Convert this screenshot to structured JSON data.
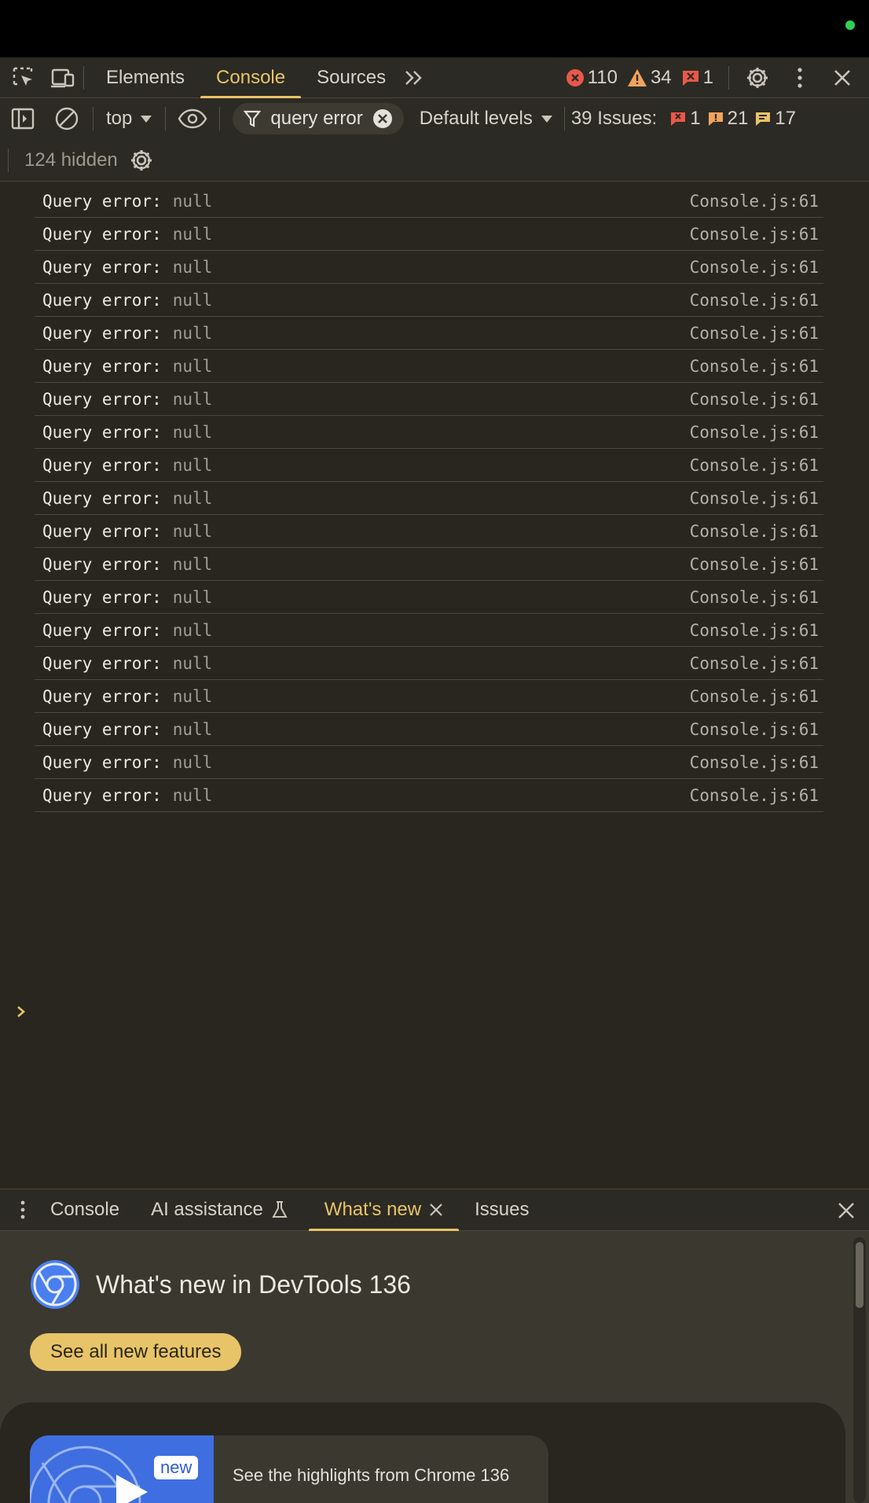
{
  "main_tabs": [
    {
      "label": "Elements",
      "active": false
    },
    {
      "label": "Console",
      "active": true
    },
    {
      "label": "Sources",
      "active": false
    }
  ],
  "counts": {
    "errors": "110",
    "warnings": "34",
    "issues_flag": "1"
  },
  "toolbar": {
    "context": "top",
    "filter_text": "query error",
    "levels": "Default levels",
    "issues_label": "39 Issues:",
    "issues_errors": "1",
    "issues_warnings": "21",
    "issues_info": "17",
    "hidden": "124 hidden"
  },
  "messages": [
    {
      "label": "Query error:",
      "value": "null",
      "source": "Console.js:61"
    },
    {
      "label": "Query error:",
      "value": "null",
      "source": "Console.js:61"
    },
    {
      "label": "Query error:",
      "value": "null",
      "source": "Console.js:61"
    },
    {
      "label": "Query error:",
      "value": "null",
      "source": "Console.js:61"
    },
    {
      "label": "Query error:",
      "value": "null",
      "source": "Console.js:61"
    },
    {
      "label": "Query error:",
      "value": "null",
      "source": "Console.js:61"
    },
    {
      "label": "Query error:",
      "value": "null",
      "source": "Console.js:61"
    },
    {
      "label": "Query error:",
      "value": "null",
      "source": "Console.js:61"
    },
    {
      "label": "Query error:",
      "value": "null",
      "source": "Console.js:61"
    },
    {
      "label": "Query error:",
      "value": "null",
      "source": "Console.js:61"
    },
    {
      "label": "Query error:",
      "value": "null",
      "source": "Console.js:61"
    },
    {
      "label": "Query error:",
      "value": "null",
      "source": "Console.js:61"
    },
    {
      "label": "Query error:",
      "value": "null",
      "source": "Console.js:61"
    },
    {
      "label": "Query error:",
      "value": "null",
      "source": "Console.js:61"
    },
    {
      "label": "Query error:",
      "value": "null",
      "source": "Console.js:61"
    },
    {
      "label": "Query error:",
      "value": "null",
      "source": "Console.js:61"
    },
    {
      "label": "Query error:",
      "value": "null",
      "source": "Console.js:61"
    },
    {
      "label": "Query error:",
      "value": "null",
      "source": "Console.js:61"
    },
    {
      "label": "Query error:",
      "value": "null",
      "source": "Console.js:61"
    }
  ],
  "drawer_tabs": [
    {
      "label": "Console",
      "active": false
    },
    {
      "label": "AI assistance",
      "active": false
    },
    {
      "label": "What's new",
      "active": true
    },
    {
      "label": "Issues",
      "active": false
    }
  ],
  "whats_new": {
    "title": "What's new in DevTools 136",
    "button": "See all new features",
    "badge": "new",
    "video_text": "See the highlights from Chrome 136"
  },
  "colors": {
    "accent": "#e8c468",
    "error": "#e8584a",
    "warning": "#f0a35e",
    "status_dot": "#2fd152"
  }
}
